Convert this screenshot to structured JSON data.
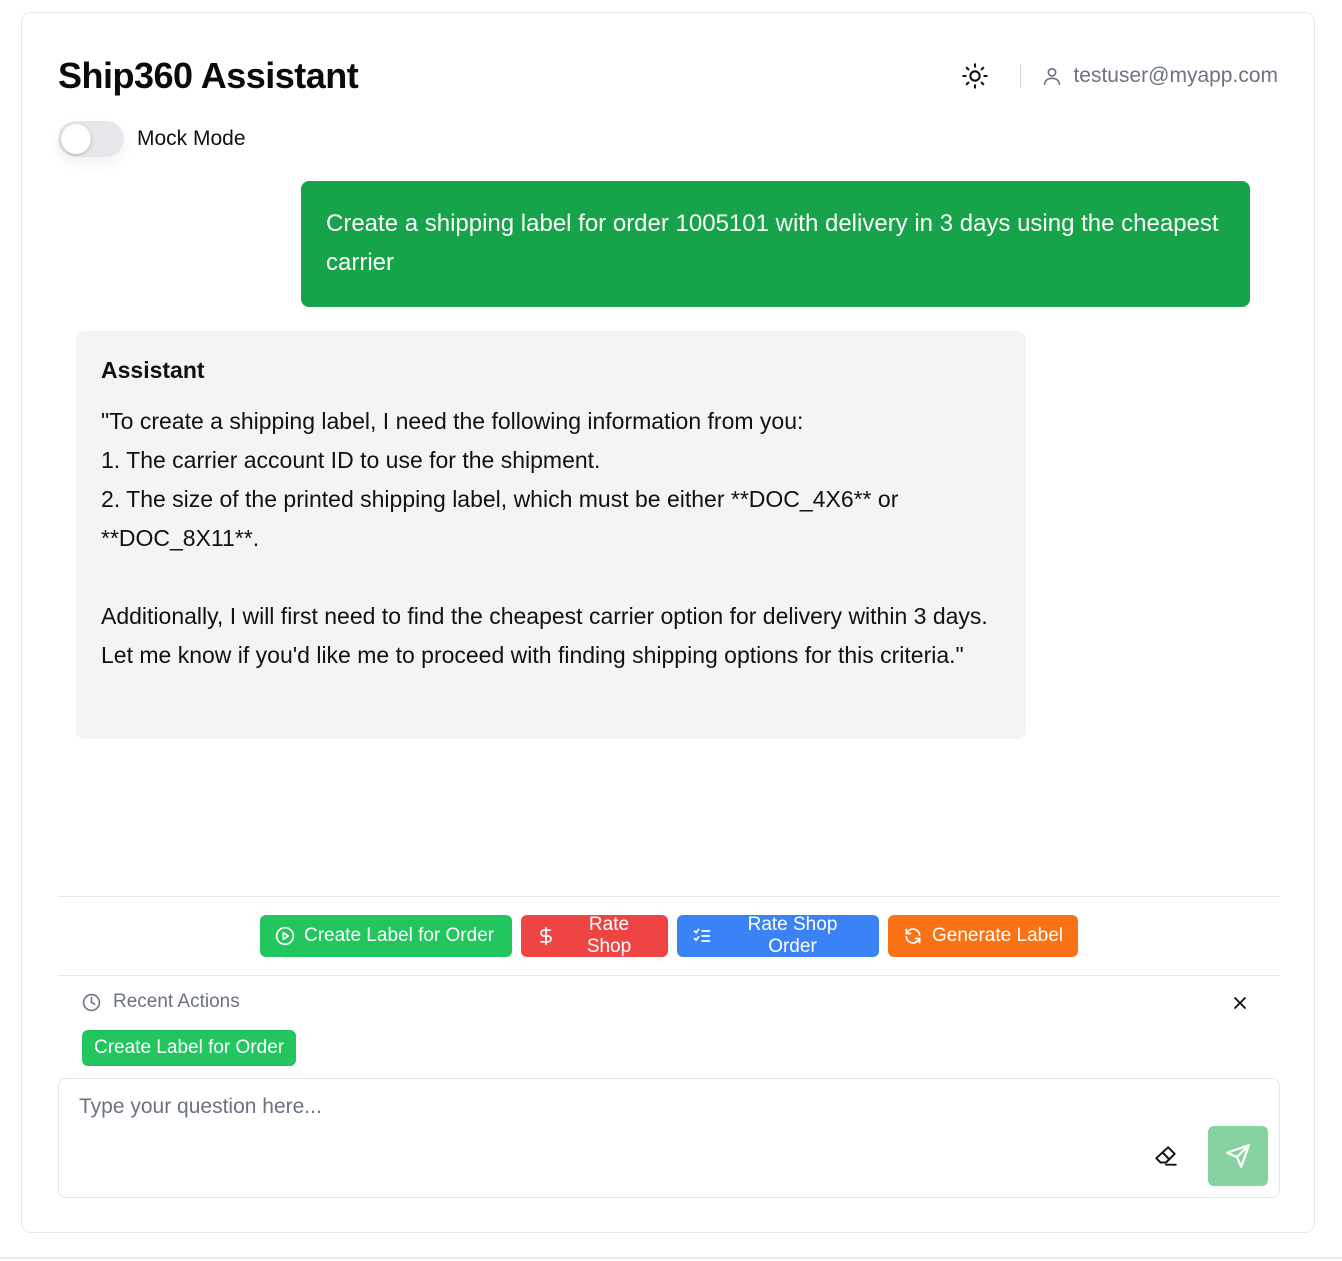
{
  "app": {
    "title": "Ship360 Assistant"
  },
  "header": {
    "user_email": "testuser@myapp.com"
  },
  "mock_mode": {
    "label": "Mock Mode",
    "enabled": false
  },
  "messages": [
    {
      "role": "user",
      "text": "Create a shipping label for order 1005101  with delivery in 3 days using the cheapest carrier"
    },
    {
      "role": "assistant",
      "name": "Assistant",
      "text": "\"To create a shipping label, I need the following information from you:\n1. The carrier account ID to use for the shipment.\n2. The size of the printed shipping label, which must be either **DOC_4X6** or **DOC_8X11**.\n\nAdditionally, I will first need to find the cheapest carrier option for delivery within 3 days. Let me know if you'd like me to proceed with finding shipping options for this criteria.\""
    }
  ],
  "quick_actions": [
    {
      "label": "Create Label for Order",
      "icon": "play-circle-icon",
      "color": "#22c55e"
    },
    {
      "label": "Rate Shop",
      "icon": "dollar-icon",
      "color": "#ef4444"
    },
    {
      "label": "Rate Shop Order",
      "icon": "checklist-icon",
      "color": "#3b82f6"
    },
    {
      "label": "Generate Label",
      "icon": "refresh-icon",
      "color": "#f97316"
    }
  ],
  "recent": {
    "title": "Recent Actions",
    "items": [
      "Create Label for Order"
    ]
  },
  "input": {
    "placeholder": "Type your question here...",
    "value": ""
  },
  "colors": {
    "accent_green": "#16a34a",
    "send_button": "#86d3a1"
  }
}
